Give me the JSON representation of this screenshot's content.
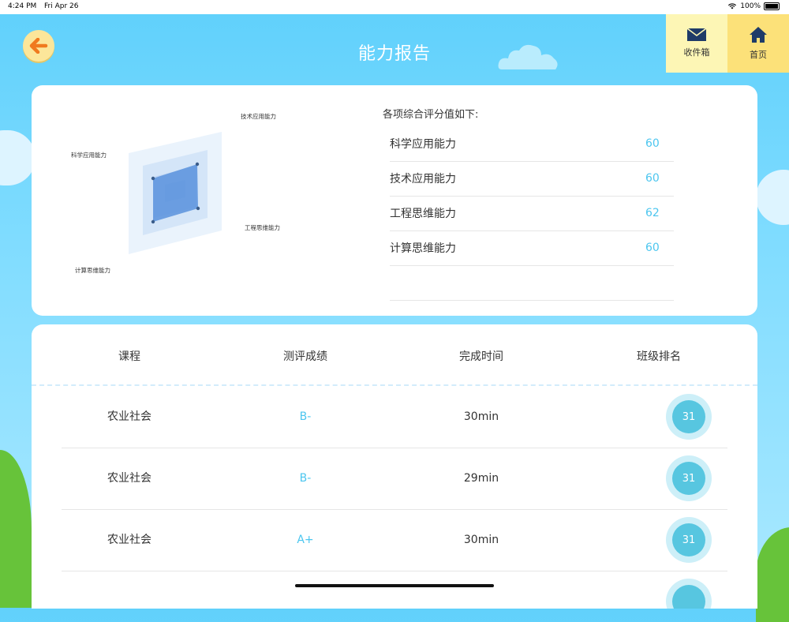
{
  "status": {
    "time": "4:24 PM",
    "date": "Fri Apr 26",
    "battery": "100%"
  },
  "header": {
    "title": "能力报告",
    "inbox_label": "收件箱",
    "home_label": "首页"
  },
  "radar": {
    "labels": {
      "science": "科学应用能力",
      "tech": "技术应用能力",
      "engineering": "工程思维能力",
      "computing": "计算思维能力"
    }
  },
  "scores": {
    "heading": "各项综合评分值如下:",
    "items": [
      {
        "name": "科学应用能力",
        "value": "60"
      },
      {
        "name": "技术应用能力",
        "value": "60"
      },
      {
        "name": "工程思维能力",
        "value": "62"
      },
      {
        "name": "计算思维能力",
        "value": "60"
      }
    ]
  },
  "table": {
    "headers": [
      "课程",
      "测评成绩",
      "完成时间",
      "班级排名"
    ],
    "rows": [
      {
        "course": "农业社会",
        "grade": "B-",
        "time": "30min",
        "rank": "31"
      },
      {
        "course": "农业社会",
        "grade": "B-",
        "time": "29min",
        "rank": "31"
      },
      {
        "course": "农业社会",
        "grade": "A+",
        "time": "30min",
        "rank": "31"
      },
      {
        "course": "",
        "grade": "",
        "time": "",
        "rank": ""
      }
    ]
  },
  "colors": {
    "accent": "#4cc6ef",
    "sky": "#5fd0fb",
    "rank_badge": "#57c6e0"
  }
}
